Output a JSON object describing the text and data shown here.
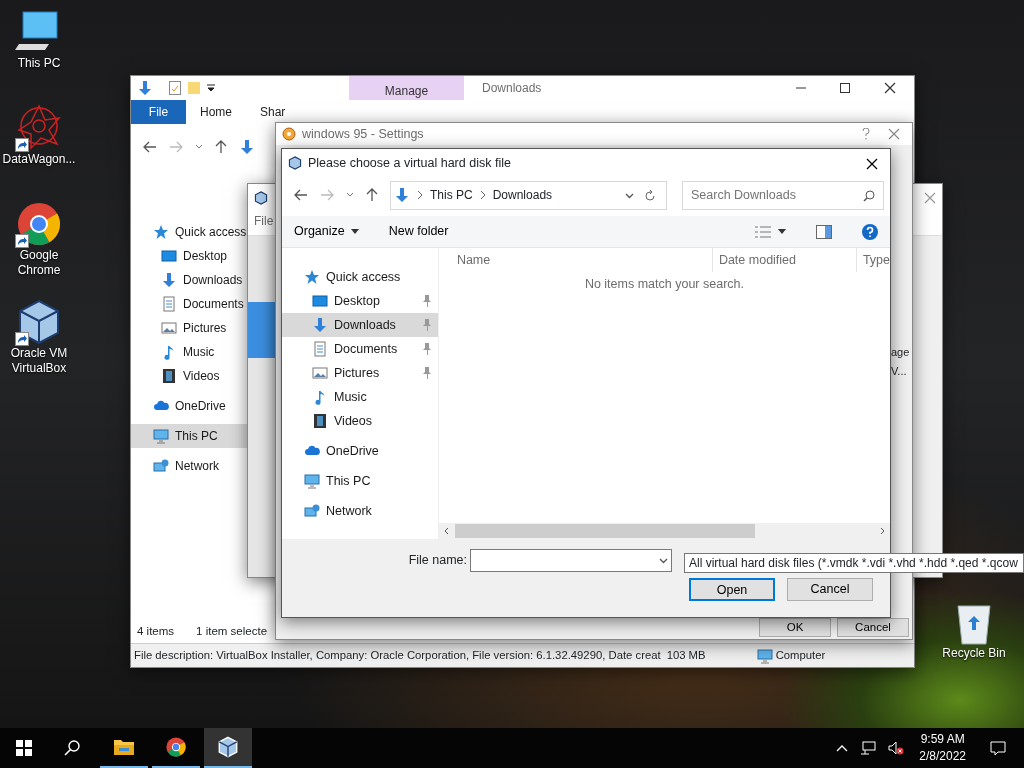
{
  "desktop_icons": [
    {
      "kind": "pc",
      "label": "This PC",
      "shortcut": false
    },
    {
      "kind": "burst",
      "label": "DataWagon...",
      "shortcut": true
    },
    {
      "kind": "chrome",
      "label": "Google Chrome",
      "shortcut": true
    },
    {
      "kind": "vbox",
      "label": "Oracle VM VirtualBox",
      "shortcut": true
    }
  ],
  "recycle_bin": {
    "label": "Recycle Bin"
  },
  "explorer": {
    "title": "Downloads",
    "context_tab": "Manage",
    "tabs": [
      {
        "label": "File",
        "selected": true
      },
      {
        "label": "Home",
        "selected": false
      },
      {
        "label": "Shar",
        "selected": false
      }
    ],
    "nav": [
      {
        "label": "Quick access",
        "kind": "star",
        "selected": false,
        "children": [
          {
            "label": "Desktop",
            "kind": "desktop",
            "selected": false
          },
          {
            "label": "Downloads",
            "kind": "down",
            "selected": false
          },
          {
            "label": "Documents",
            "kind": "doc",
            "selected": false
          },
          {
            "label": "Pictures",
            "kind": "pic",
            "selected": false
          },
          {
            "label": "Music",
            "kind": "music",
            "selected": false
          },
          {
            "label": "Videos",
            "kind": "video",
            "selected": false
          }
        ]
      },
      {
        "label": "OneDrive",
        "kind": "cloud",
        "selected": false
      },
      {
        "label": "This PC",
        "kind": "pc",
        "selected": true
      },
      {
        "label": "Network",
        "kind": "net",
        "selected": false
      }
    ],
    "status": {
      "count": "4 items",
      "selection": "1 item selecte"
    },
    "details": {
      "description": "File description: VirtualBox Installer, Company: Oracle Corporation, File version: 6.1.32.49290, Date creat",
      "size": "103 MB",
      "zone": "Computer"
    }
  },
  "manager_window": {
    "menu": "File"
  },
  "settings_window": {
    "title": "windows 95 - Settings",
    "fragments": [
      "age",
      "V..."
    ],
    "buttons": [
      "OK",
      "Cancel"
    ]
  },
  "dialog": {
    "title": "Please choose a virtual hard disk file",
    "breadcrumb": [
      "This PC",
      "Downloads"
    ],
    "search": {
      "placeholder": "Search Downloads"
    },
    "toolbar": [
      "Organize",
      "New folder"
    ],
    "columns": [
      "Name",
      "Date modified",
      "Type"
    ],
    "empty_message": "No items match your search.",
    "nav": [
      {
        "label": "Quick access",
        "kind": "star",
        "selected": false,
        "children": [
          {
            "label": "Desktop",
            "kind": "desktop",
            "selected": false,
            "pinned": true
          },
          {
            "label": "Downloads",
            "kind": "down",
            "selected": true,
            "pinned": true
          },
          {
            "label": "Documents",
            "kind": "doc",
            "selected": false,
            "pinned": true
          },
          {
            "label": "Pictures",
            "kind": "pic",
            "selected": false,
            "pinned": true
          },
          {
            "label": "Music",
            "kind": "music",
            "selected": false,
            "pinned": false
          },
          {
            "label": "Videos",
            "kind": "video",
            "selected": false,
            "pinned": false
          }
        ]
      },
      {
        "label": "OneDrive",
        "kind": "cloud",
        "selected": false
      },
      {
        "label": "This PC",
        "kind": "pc",
        "selected": false
      },
      {
        "label": "Network",
        "kind": "net",
        "selected": false
      }
    ],
    "file_name_label": "File name:",
    "file_type": "All virtual hard disk files (*.vmdk *.vdi *.vhd *.hdd *.qed *.qcow",
    "buttons": [
      {
        "label": "Open",
        "default": true
      },
      {
        "label": "Cancel",
        "default": false
      }
    ]
  },
  "taskbar": {
    "apps": [
      {
        "kind": "folder",
        "selected": false
      },
      {
        "kind": "chrome",
        "selected": false
      },
      {
        "kind": "vbox",
        "selected": true
      }
    ],
    "time": "9:59 AM",
    "date": "2/8/2022"
  }
}
